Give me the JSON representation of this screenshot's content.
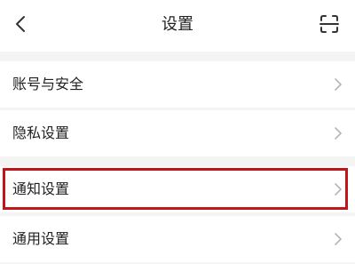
{
  "header": {
    "title": "设置",
    "back_icon": "chevron-left-icon",
    "scan_icon": "scan-icon"
  },
  "settings": {
    "items": [
      {
        "label": "账号与安全",
        "icon": "chevron-right-icon"
      },
      {
        "label": "隐私设置",
        "icon": "chevron-right-icon"
      },
      {
        "label": "通知设置",
        "icon": "chevron-right-icon",
        "highlighted": true
      },
      {
        "label": "通用设置",
        "icon": "chevron-right-icon"
      }
    ]
  },
  "colors": {
    "background": "#f4f4f4",
    "surface": "#ffffff",
    "text": "#222222",
    "chevron": "#b5b5b5",
    "highlight_border": "#c0161b"
  }
}
